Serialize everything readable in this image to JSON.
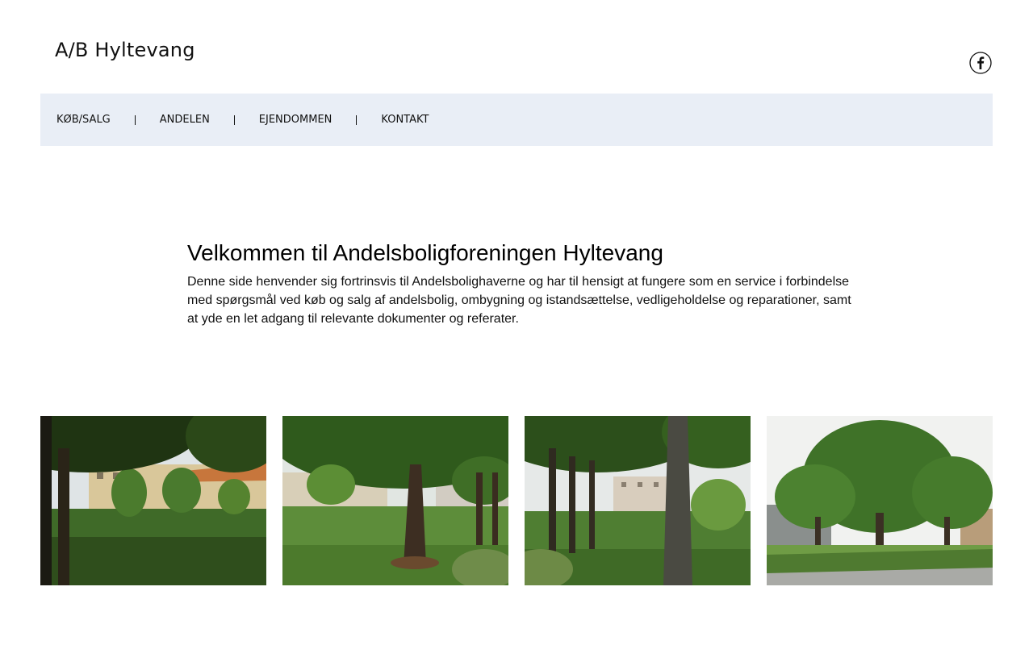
{
  "header": {
    "site_title": "A/B Hyltevang",
    "social": {
      "icon": "facebook-icon"
    }
  },
  "nav": {
    "items": [
      {
        "label": "KØB/SALG"
      },
      {
        "label": "ANDELEN"
      },
      {
        "label": "EJENDOMMEN"
      },
      {
        "label": "KONTAKT"
      }
    ],
    "background": "#e9eef6"
  },
  "intro": {
    "heading": "Velkommen til Andelsboligforeningen Hyltevang",
    "body": "Denne side henvender sig fortrinsvis til Andelsbolighaverne og har til hensigt at fungere som en service i forbindelse med spørgsmål ved køb og salg af andelsbolig, ombygning og istandsættelse, vedligeholdelse og reparationer, samt at yde en let adgang til relevante dokumenter og referater."
  },
  "gallery": {
    "photos": [
      {
        "subject": "park-with-trees-photo"
      },
      {
        "subject": "tree-trunk-lawn-photo"
      },
      {
        "subject": "tree-row-buildings-photo"
      },
      {
        "subject": "hedge-and-trees-photo"
      }
    ]
  }
}
